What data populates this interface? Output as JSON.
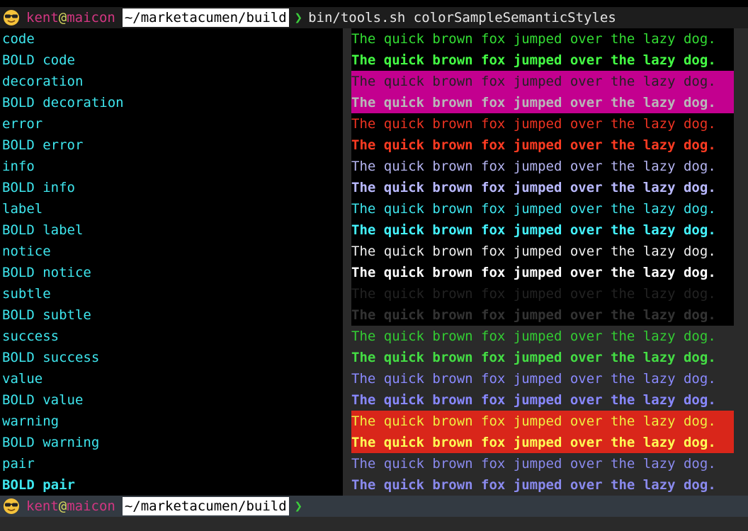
{
  "prompt": {
    "user": "kent",
    "at": "@",
    "host": "maicon",
    "path": "~/marketacumen/build",
    "chevron": "❯",
    "command": "bin/tools.sh colorSampleSemanticStyles",
    "emoji_icon": "sunglasses-face-icon"
  },
  "colors": {
    "label": "#3ee6ee",
    "user": "#d33682",
    "at": "#d7d760",
    "chevron": "#3ccc3c",
    "right_pane_bg": "#2a2a2a",
    "bottom_bar_bg": "#333a42"
  },
  "sample_text": "The quick brown fox jumped over the lazy dog.",
  "rows": [
    {
      "label": "code",
      "bold": false,
      "fg": "#33dd33",
      "bg": "#000000"
    },
    {
      "label": "BOLD code",
      "bold": true,
      "fg": "#44ff44",
      "bg": "#000000"
    },
    {
      "label": "decoration",
      "bold": false,
      "fg": "#222222",
      "bg": "#c3008f"
    },
    {
      "label": "BOLD decoration",
      "bold": true,
      "fg": "#b8b8b8",
      "bg": "#c3008f"
    },
    {
      "label": "error",
      "bold": false,
      "fg": "#ee3322",
      "bg": "#000000"
    },
    {
      "label": "BOLD error",
      "bold": true,
      "fg": "#ff3b22",
      "bg": "#000000"
    },
    {
      "label": "info",
      "bold": false,
      "fg": "#b4b4f0",
      "bg": "#000000"
    },
    {
      "label": "BOLD info",
      "bold": true,
      "fg": "#b9b9ff",
      "bg": "#000000"
    },
    {
      "label": "label",
      "bold": false,
      "fg": "#3ee6ee",
      "bg": "#000000"
    },
    {
      "label": "BOLD label",
      "bold": true,
      "fg": "#44f4ff",
      "bg": "#000000"
    },
    {
      "label": "notice",
      "bold": false,
      "fg": "#f0f0f0",
      "bg": "#000000"
    },
    {
      "label": "BOLD notice",
      "bold": true,
      "fg": "#ffffff",
      "bg": "#000000"
    },
    {
      "label": "subtle",
      "bold": false,
      "fg": "#222222",
      "bg": "#000000"
    },
    {
      "label": "BOLD subtle",
      "bold": true,
      "fg": "#333333",
      "bg": "#000000"
    },
    {
      "label": "success",
      "bold": false,
      "fg": "#33cc33",
      "bg": "#2a2a2a"
    },
    {
      "label": "BOLD success",
      "bold": true,
      "fg": "#44dd44",
      "bg": "#2a2a2a"
    },
    {
      "label": "value",
      "bold": false,
      "fg": "#8a8aff",
      "bg": "#2a2a2a"
    },
    {
      "label": "BOLD value",
      "bold": true,
      "fg": "#8888ff",
      "bg": "#2a2a2a"
    },
    {
      "label": "warning",
      "bold": false,
      "fg": "#f0f040",
      "bg": "#d9261a"
    },
    {
      "label": "BOLD warning",
      "bold": true,
      "fg": "#ffff55",
      "bg": "#d9261a"
    },
    {
      "label": "pair",
      "bold": false,
      "fg": "#8a8aee",
      "bg": "#2a2a2a"
    },
    {
      "label": "BOLD pair",
      "bold": true,
      "fg": "#8a8aee",
      "bg": "#2a2a2a"
    }
  ]
}
